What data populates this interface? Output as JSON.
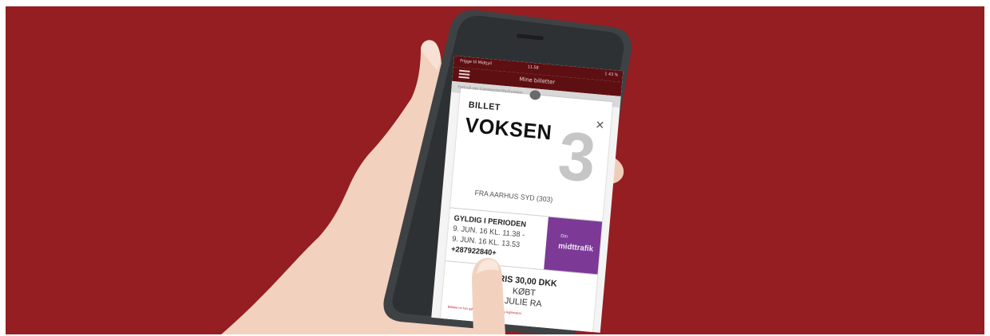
{
  "scene": {
    "description_colors": {
      "background": "#941e22",
      "phone_body": "#3f4244",
      "skin": "#f3d6c4",
      "ticket_accent": "#7c3a96"
    }
  },
  "phone": {
    "status_bar": {
      "carrier": "Frigge til Midtjyll",
      "time": "11.58",
      "battery": "1 43 %"
    },
    "app_bar": {
      "title": "Mine billetter",
      "menu_icon": "hamburger-menu-icon"
    },
    "sub_header": "Fortryll om transportertforbunden",
    "ticket": {
      "label": "BILLET",
      "type": "VOKSEN",
      "zone": "3",
      "close_icon": "close-icon",
      "origin": "FRA AARHUS SYD (303)",
      "validity": {
        "heading": "GYLDIG I PERIODEN",
        "from": "9. JUN. 16 KL. 11.38 -",
        "to": "9. JUN. 16 KL. 13.53",
        "code": "+287922840+"
      },
      "logo": {
        "small_text": "Din",
        "text": "midttrafik",
        "color": "#7c3a96"
      },
      "price": "PRIS 30,00 DKK",
      "buyer_prefix": "KØBT",
      "buyer_name": "JULIE RA",
      "fine_print": "Billetten er kun gyldig sammen med gyldig legitimation"
    }
  }
}
